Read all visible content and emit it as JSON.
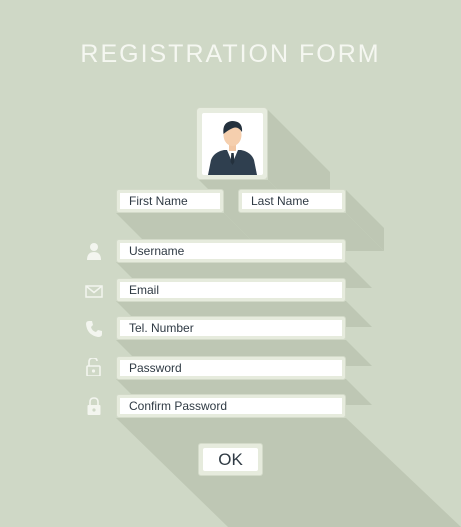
{
  "form": {
    "title": "REGISTRATION FORM",
    "fields": {
      "first_name": "First Name",
      "last_name": "Last Name",
      "username": "Username",
      "email": "Email",
      "tel_number": "Tel. Number",
      "password": "Password",
      "confirm_password": "Confirm Password"
    },
    "submit_label": "OK"
  },
  "icons": {
    "avatar": "user-avatar-icon",
    "username": "user-icon",
    "email": "envelope-icon",
    "tel_number": "phone-icon",
    "password": "unlocked-padlock-icon",
    "confirm_password": "locked-padlock-icon"
  },
  "colors": {
    "background": "#cfd8c6",
    "shadow": "#bcc5b3",
    "field_frame": "#e6ebdd",
    "field_fill": "#ffffff",
    "text": "#2f3a44",
    "icon": "#f3f5ef",
    "title": "#f5f7f1"
  }
}
